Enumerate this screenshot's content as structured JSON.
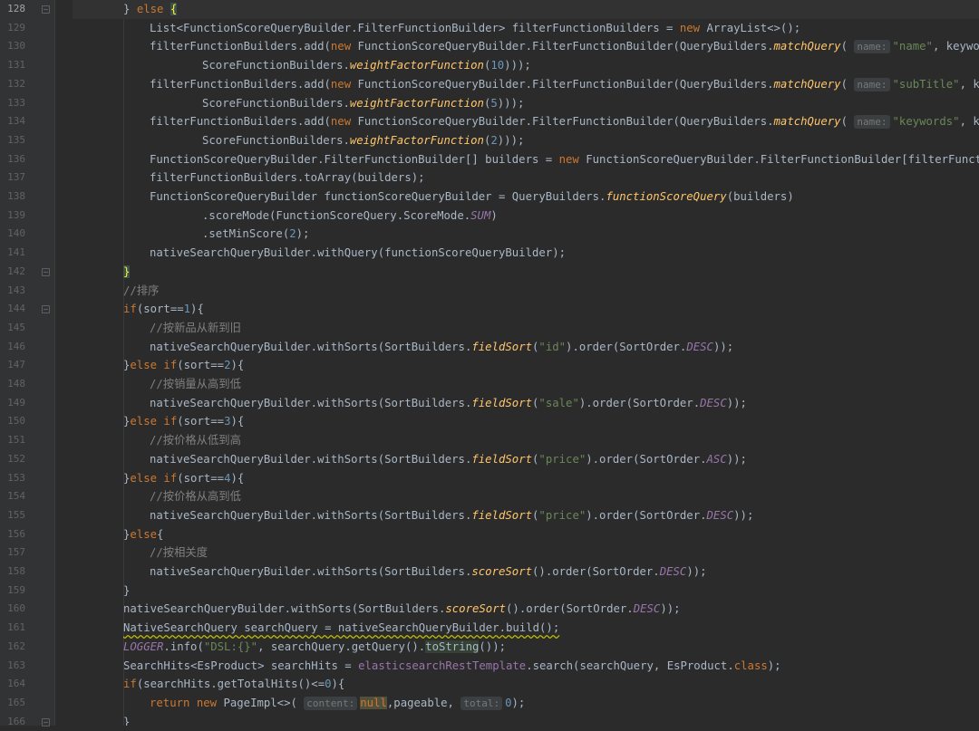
{
  "gutter": {
    "line_numbers": [
      "128",
      "129",
      "130",
      "131",
      "132",
      "133",
      "134",
      "135",
      "136",
      "137",
      "138",
      "139",
      "140",
      "141",
      "142",
      "143",
      "144",
      "145",
      "146",
      "147",
      "148",
      "149",
      "150",
      "151",
      "152",
      "153",
      "154",
      "155",
      "156",
      "157",
      "158",
      "159",
      "160",
      "161",
      "162",
      "163",
      "164",
      "165",
      "166"
    ],
    "current_line": "128"
  },
  "hints": {
    "name": "name:",
    "content": "content:",
    "total": "total:"
  },
  "lines": {
    "l128": {
      "c1": "} ",
      "c2": "else",
      "c3": " ",
      "c4": "{"
    },
    "l129": {
      "c1": "List<FunctionScoreQueryBuilder.FilterFunctionBuilder> filterFunctionBuilders = ",
      "c2": "new",
      "c3": " ArrayList<>();"
    },
    "l130": {
      "c1": "filterFunctionBuilders.add(",
      "c2": "new",
      "c3": " FunctionScoreQueryBuilder.FilterFunctionBuilder(QueryBuilders.",
      "c4": "matchQuery",
      "c5": "( ",
      "c6": "\"name\"",
      "c7": ", keyword"
    },
    "l131": {
      "c1": "ScoreFunctionBuilders.",
      "c2": "weightFactorFunction",
      "c3": "(",
      "c4": "10",
      "c5": ")));"
    },
    "l132": {
      "c1": "filterFunctionBuilders.add(",
      "c2": "new",
      "c3": " FunctionScoreQueryBuilder.FilterFunctionBuilder(QueryBuilders.",
      "c4": "matchQuery",
      "c5": "( ",
      "c6": "\"subTitle\"",
      "c7": ", key"
    },
    "l133": {
      "c1": "ScoreFunctionBuilders.",
      "c2": "weightFactorFunction",
      "c3": "(",
      "c4": "5",
      "c5": ")));"
    },
    "l134": {
      "c1": "filterFunctionBuilders.add(",
      "c2": "new",
      "c3": " FunctionScoreQueryBuilder.FilterFunctionBuilder(QueryBuilders.",
      "c4": "matchQuery",
      "c5": "( ",
      "c6": "\"keywords\"",
      "c7": ", key"
    },
    "l135": {
      "c1": "ScoreFunctionBuilders.",
      "c2": "weightFactorFunction",
      "c3": "(",
      "c4": "2",
      "c5": ")));"
    },
    "l136": {
      "c1": "FunctionScoreQueryBuilder.FilterFunctionBuilder[] builders = ",
      "c2": "new",
      "c3": " FunctionScoreQueryBuilder.FilterFunctionBuilder[filterFunctio"
    },
    "l137": {
      "c1": "filterFunctionBuilders.toArray(builders);"
    },
    "l138": {
      "c1": "FunctionScoreQueryBuilder functionScoreQueryBuilder = QueryBuilders.",
      "c2": "functionScoreQuery",
      "c3": "(builders)"
    },
    "l139": {
      "c1": ".scoreMode(FunctionScoreQuery.ScoreMode.",
      "c2": "SUM",
      "c3": ")"
    },
    "l140": {
      "c1": ".setMinScore(",
      "c2": "2",
      "c3": ");"
    },
    "l141": {
      "c1": "nativeSearchQueryBuilder.withQuery(functionScoreQueryBuilder);"
    },
    "l142": {
      "c1": "}"
    },
    "l143": {
      "c1": "//排序"
    },
    "l144": {
      "c1": "if",
      "c2": "(sort==",
      "c3": "1",
      "c4": "){"
    },
    "l145": {
      "c1": "//按新品从新到旧"
    },
    "l146": {
      "c1": "nativeSearchQueryBuilder.withSorts(SortBuilders.",
      "c2": "fieldSort",
      "c3": "(",
      "c4": "\"id\"",
      "c5": ").order(SortOrder.",
      "c6": "DESC",
      "c7": "));"
    },
    "l147": {
      "c1": "}",
      "c2": "else if",
      "c3": "(sort==",
      "c4": "2",
      "c5": "){"
    },
    "l148": {
      "c1": "//按销量从高到低"
    },
    "l149": {
      "c1": "nativeSearchQueryBuilder.withSorts(SortBuilders.",
      "c2": "fieldSort",
      "c3": "(",
      "c4": "\"sale\"",
      "c5": ").order(SortOrder.",
      "c6": "DESC",
      "c7": "));"
    },
    "l150": {
      "c1": "}",
      "c2": "else if",
      "c3": "(sort==",
      "c4": "3",
      "c5": "){"
    },
    "l151": {
      "c1": "//按价格从低到高"
    },
    "l152": {
      "c1": "nativeSearchQueryBuilder.withSorts(SortBuilders.",
      "c2": "fieldSort",
      "c3": "(",
      "c4": "\"price\"",
      "c5": ").order(SortOrder.",
      "c6": "ASC",
      "c7": "));"
    },
    "l153": {
      "c1": "}",
      "c2": "else if",
      "c3": "(sort==",
      "c4": "4",
      "c5": "){"
    },
    "l154": {
      "c1": "//按价格从高到低"
    },
    "l155": {
      "c1": "nativeSearchQueryBuilder.withSorts(SortBuilders.",
      "c2": "fieldSort",
      "c3": "(",
      "c4": "\"price\"",
      "c5": ").order(SortOrder.",
      "c6": "DESC",
      "c7": "));"
    },
    "l156": {
      "c1": "}",
      "c2": "else",
      "c3": "{"
    },
    "l157": {
      "c1": "//按相关度"
    },
    "l158": {
      "c1": "nativeSearchQueryBuilder.withSorts(SortBuilders.",
      "c2": "scoreSort",
      "c3": "().order(SortOrder.",
      "c4": "DESC",
      "c5": "));"
    },
    "l159": {
      "c1": "}"
    },
    "l160": {
      "c1": "nativeSearchQueryBuilder.withSorts(SortBuilders.",
      "c2": "scoreSort",
      "c3": "().order(SortOrder.",
      "c4": "DESC",
      "c5": "));"
    },
    "l161": {
      "c1": "NativeSearchQuery searchQuery = nativeSearchQueryBuilder.build();"
    },
    "l162": {
      "c1": "LOGGER",
      "c2": ".info(",
      "c3": "\"DSL:{}\"",
      "c4": ", searchQuery.getQuery().",
      "c5": "toString",
      "c6": "());"
    },
    "l163": {
      "c1": "SearchHits<EsProduct> searchHits = ",
      "c2": "elasticsearchRestTemplate",
      "c3": ".search(searchQuery, EsProduct.",
      "c4": "class",
      "c5": ");"
    },
    "l164": {
      "c1": "if",
      "c2": "(searchHits.getTotalHits()<=",
      "c3": "0",
      "c4": "){"
    },
    "l165": {
      "c1": "return new",
      "c2": " PageImpl<>( ",
      "c3": "null",
      "c4": ",pageable, ",
      "c5": "0",
      "c6": ");"
    },
    "l166": {
      "c1": "}"
    }
  }
}
